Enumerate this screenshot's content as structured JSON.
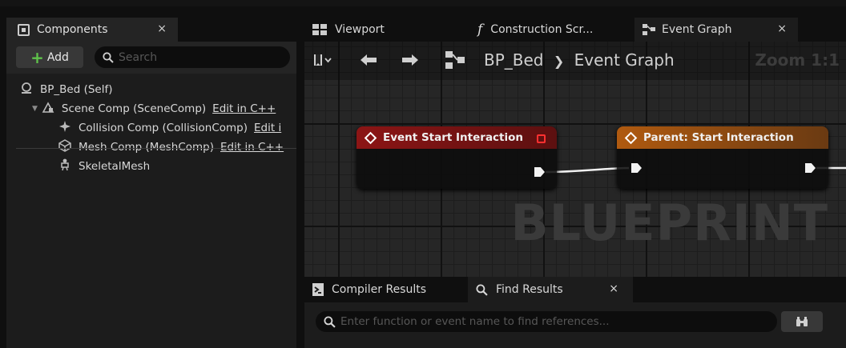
{
  "components_panel": {
    "tab_label": "Components",
    "close_glyph": "×",
    "add_label": "Add",
    "search_placeholder": "Search",
    "tree": [
      {
        "label": "BP_Bed (Self)",
        "icon": "actor-icon"
      },
      {
        "label": "Scene Comp (SceneComp)",
        "link": "Edit in C++",
        "icon": "scene-component-icon"
      },
      {
        "label": "Collision Comp (CollisionComp)",
        "link": "Edit i",
        "icon": "collision-icon"
      },
      {
        "label": "Mesh Comp (MeshComp)",
        "link": "Edit in C++",
        "icon": "mesh-icon"
      },
      {
        "label": "SkeletalMesh",
        "icon": "skeletal-mesh-icon"
      }
    ]
  },
  "editor_tabs": [
    {
      "label": "Viewport",
      "icon": "viewport-icon"
    },
    {
      "label": "Construction Scr...",
      "icon": "function-icon"
    },
    {
      "label": "Event Graph",
      "icon": "graph-icon",
      "active": true,
      "close": "×"
    }
  ],
  "graph": {
    "breadcrumb_root": "BP_Bed",
    "breadcrumb_sep": "❯",
    "breadcrumb_current": "Event Graph",
    "zoom": "Zoom 1:1",
    "watermark": "BLUEPRINT",
    "nodes": [
      {
        "title": "Event Start Interaction",
        "color": "#8c1515"
      },
      {
        "title": "Parent: Start Interaction",
        "color": "#b05a10"
      }
    ]
  },
  "bottom_panel": {
    "tabs": [
      {
        "label": "Compiler Results",
        "icon": "compiler-icon"
      },
      {
        "label": "Find Results",
        "icon": "search-icon",
        "active": true,
        "close": "×"
      }
    ],
    "find_placeholder": "Enter function or event name to find references..."
  }
}
